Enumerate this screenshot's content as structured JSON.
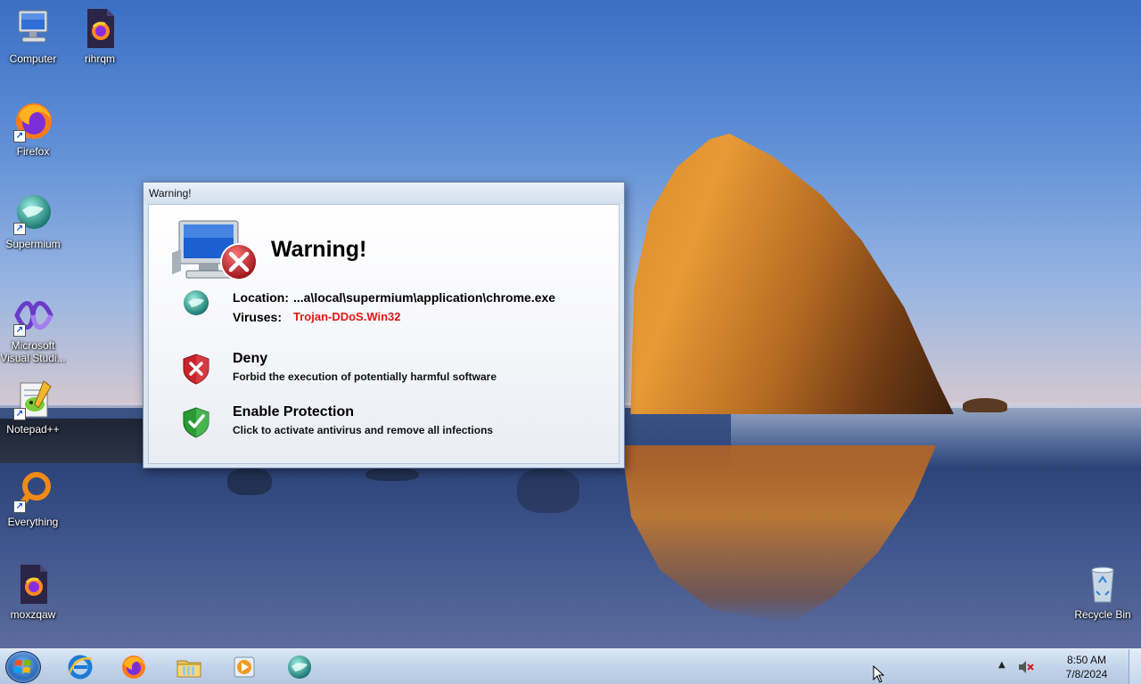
{
  "desktop": {
    "icons": [
      {
        "label": "Computer"
      },
      {
        "label": "rihrqm"
      },
      {
        "label": "Firefox"
      },
      {
        "label": "Supermium"
      },
      {
        "label": "Microsoft Visual Studi..."
      },
      {
        "label": "Notepad++"
      },
      {
        "label": "Everything"
      },
      {
        "label": "moxzqaw"
      },
      {
        "label": "Recycle Bin"
      }
    ]
  },
  "dialog": {
    "window_title": "Warning!",
    "heading": "Warning!",
    "location_label": "Location:",
    "location_value": "...a\\local\\supermium\\application\\chrome.exe",
    "viruses_label": "Viruses:",
    "viruses_value": "Trojan-DDoS.Win32",
    "options": [
      {
        "title": "Deny",
        "description": "Forbid the execution of potentially harmful software",
        "icon": "red-shield-x-icon"
      },
      {
        "title": "Enable Protection",
        "description": "Click to activate antivirus and remove all infections",
        "icon": "green-shield-check-icon"
      }
    ]
  },
  "taskbar": {
    "pinned": [
      "internet-explorer-icon",
      "firefox-icon",
      "file-explorer-icon",
      "media-player-icon",
      "supermium-icon"
    ],
    "clock_time": "8:50 AM",
    "clock_date": "7/8/2024"
  },
  "colors": {
    "virus_text": "#e01818",
    "dialog_frame": "#dbe6f3"
  }
}
